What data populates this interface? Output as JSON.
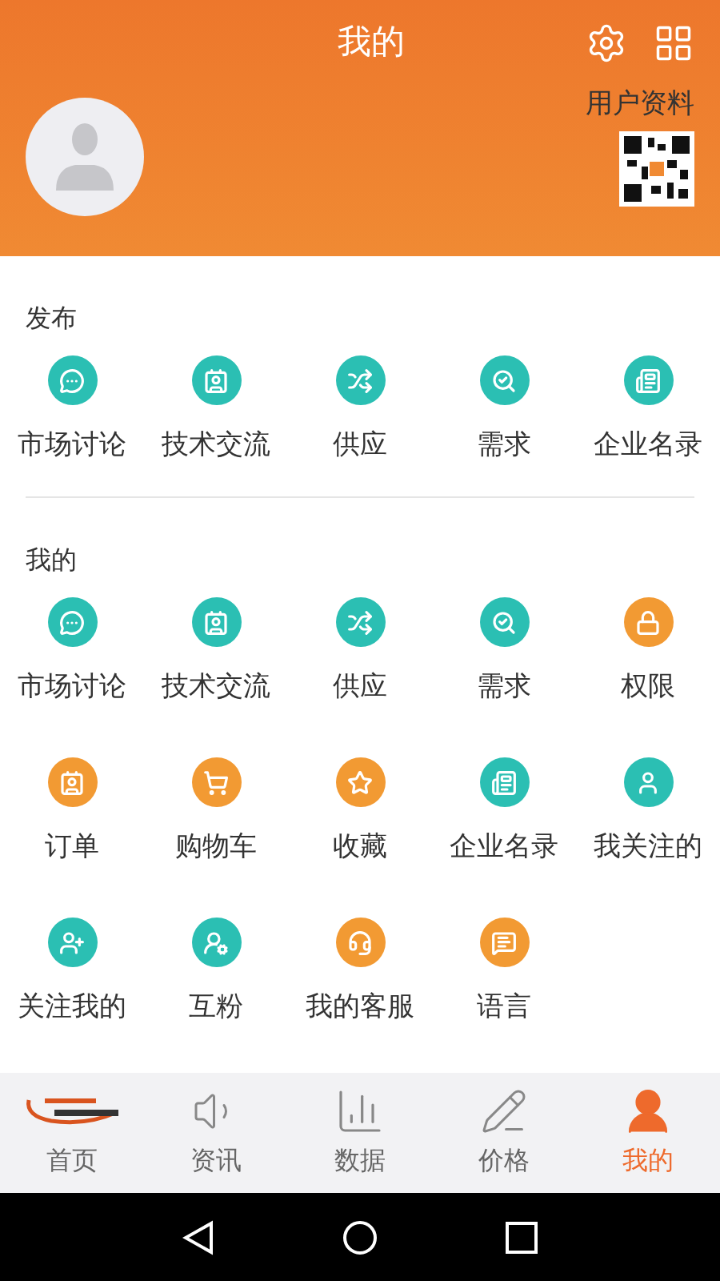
{
  "header": {
    "title": "我的",
    "profile_label": "用户资料"
  },
  "sections": [
    {
      "title": "发布",
      "items": [
        {
          "label": "市场讨论",
          "kind": "discussion",
          "color": "#2bbfb3"
        },
        {
          "label": "技术交流",
          "kind": "exchange",
          "color": "#2bbfb3"
        },
        {
          "label": "供应",
          "kind": "supply",
          "color": "#2bbfb3"
        },
        {
          "label": "需求",
          "kind": "demand",
          "color": "#2bbfb3"
        },
        {
          "label": "企业名录",
          "kind": "directory",
          "color": "#2bbfb3"
        }
      ]
    },
    {
      "title": "我的",
      "items": [
        {
          "label": "市场讨论",
          "kind": "discussion",
          "color": "#2bbfb3"
        },
        {
          "label": "技术交流",
          "kind": "exchange",
          "color": "#2bbfb3"
        },
        {
          "label": "供应",
          "kind": "supply",
          "color": "#2bbfb3"
        },
        {
          "label": "需求",
          "kind": "demand",
          "color": "#2bbfb3"
        },
        {
          "label": "权限",
          "kind": "permission",
          "color": "#f29a33"
        },
        {
          "label": "订单",
          "kind": "order",
          "color": "#f29a33"
        },
        {
          "label": "购物车",
          "kind": "cart",
          "color": "#f29a33"
        },
        {
          "label": "收藏",
          "kind": "favorite",
          "color": "#f29a33"
        },
        {
          "label": "企业名录",
          "kind": "directory",
          "color": "#2bbfb3"
        },
        {
          "label": "我关注的",
          "kind": "following",
          "color": "#2bbfb3"
        },
        {
          "label": "关注我的",
          "kind": "followers",
          "color": "#2bbfb3"
        },
        {
          "label": "互粉",
          "kind": "mutual",
          "color": "#2bbfb3"
        },
        {
          "label": "我的客服",
          "kind": "service",
          "color": "#f29a33"
        },
        {
          "label": "语言",
          "kind": "language",
          "color": "#f29a33"
        }
      ]
    }
  ],
  "tab_bar": [
    {
      "label": "首页",
      "kind": "home",
      "selected": false
    },
    {
      "label": "资讯",
      "kind": "news",
      "selected": false
    },
    {
      "label": "数据",
      "kind": "data",
      "selected": false
    },
    {
      "label": "价格",
      "kind": "price",
      "selected": false
    },
    {
      "label": "我的",
      "kind": "me",
      "selected": true
    }
  ]
}
